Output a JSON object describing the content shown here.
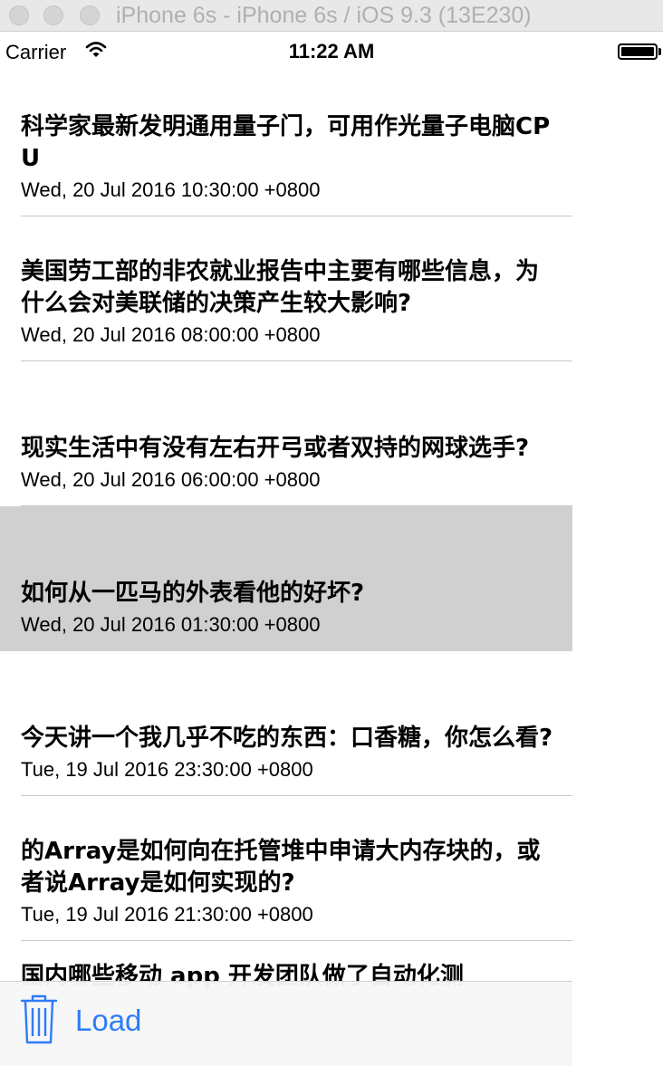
{
  "window": {
    "title": "iPhone 6s - iPhone 6s / iOS 9.3 (13E230)"
  },
  "status_bar": {
    "carrier": "Carrier",
    "time": "11:22 AM",
    "wifi_icon": "wifi-icon",
    "battery_level": 1.0
  },
  "feed": {
    "items": [
      {
        "title": "科学家最新发明通用量子门，可用作光量子电脑CPU",
        "date": "Wed, 20 Jul 2016 10:30:00 +0800"
      },
      {
        "title": "美国劳工部的非农就业报告中主要有哪些信息，为什么会对美联储的决策产生较大影响?",
        "date": "Wed, 20 Jul 2016 08:00:00 +0800"
      },
      {
        "title": "现实生活中有没有左右开弓或者双持的网球选手?",
        "date": "Wed, 20 Jul 2016 06:00:00 +0800"
      },
      {
        "title": "如何从一匹马的外表看他的好坏?",
        "date": "Wed, 20 Jul 2016 01:30:00 +0800",
        "selected": true
      },
      {
        "title": "今天讲一个我几乎不吃的东西：口香糖，你怎么看?",
        "date": "Tue, 19 Jul 2016 23:30:00 +0800"
      },
      {
        "title": "的Array是如何向在托管堆中申请大内存块的，或者说Array是如何实现的?",
        "date": "Tue, 19 Jul 2016 21:30:00 +0800"
      },
      {
        "title": "国内哪些移动 app 开发团队做了自动化测",
        "date": ""
      }
    ]
  },
  "toolbar": {
    "trash_icon": "trash-icon",
    "load_label": "Load",
    "accent": "#2f7cf6"
  }
}
